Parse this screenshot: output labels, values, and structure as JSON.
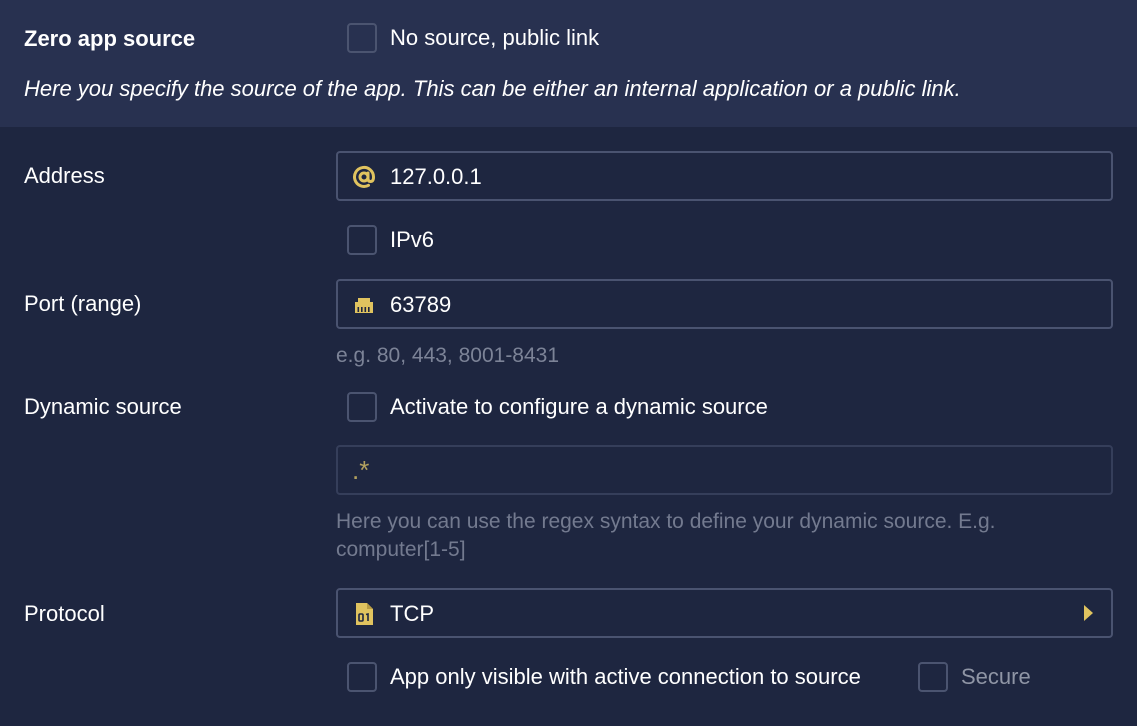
{
  "zero_app_source": {
    "label": "Zero app source",
    "checkbox_label": "No source, public link",
    "description": "Here you specify the source of the app. This can be either an internal application or a public link."
  },
  "address": {
    "label": "Address",
    "value": "127.0.0.1",
    "icon": "at-icon",
    "ipv6_label": "IPv6"
  },
  "port": {
    "label": "Port (range)",
    "value": "63789",
    "icon": "ethernet-port-icon",
    "hint": "e.g. 80, 443, 8001-8431"
  },
  "dynamic_source": {
    "label": "Dynamic source",
    "checkbox_label": "Activate to configure a dynamic source",
    "placeholder": ".*",
    "hint": "Here you can use the regex syntax to define your dynamic source. E.g. computer[1-5]"
  },
  "protocol": {
    "label": "Protocol",
    "selected": "TCP",
    "icon": "binary-file-icon"
  },
  "footer_options": {
    "visibility_label": "App only visible with active connection to source",
    "secure_label": "Secure"
  },
  "colors": {
    "background": "#1e2640",
    "header_background": "#283150",
    "accent": "#e0c35f",
    "border": "#4a5370"
  }
}
